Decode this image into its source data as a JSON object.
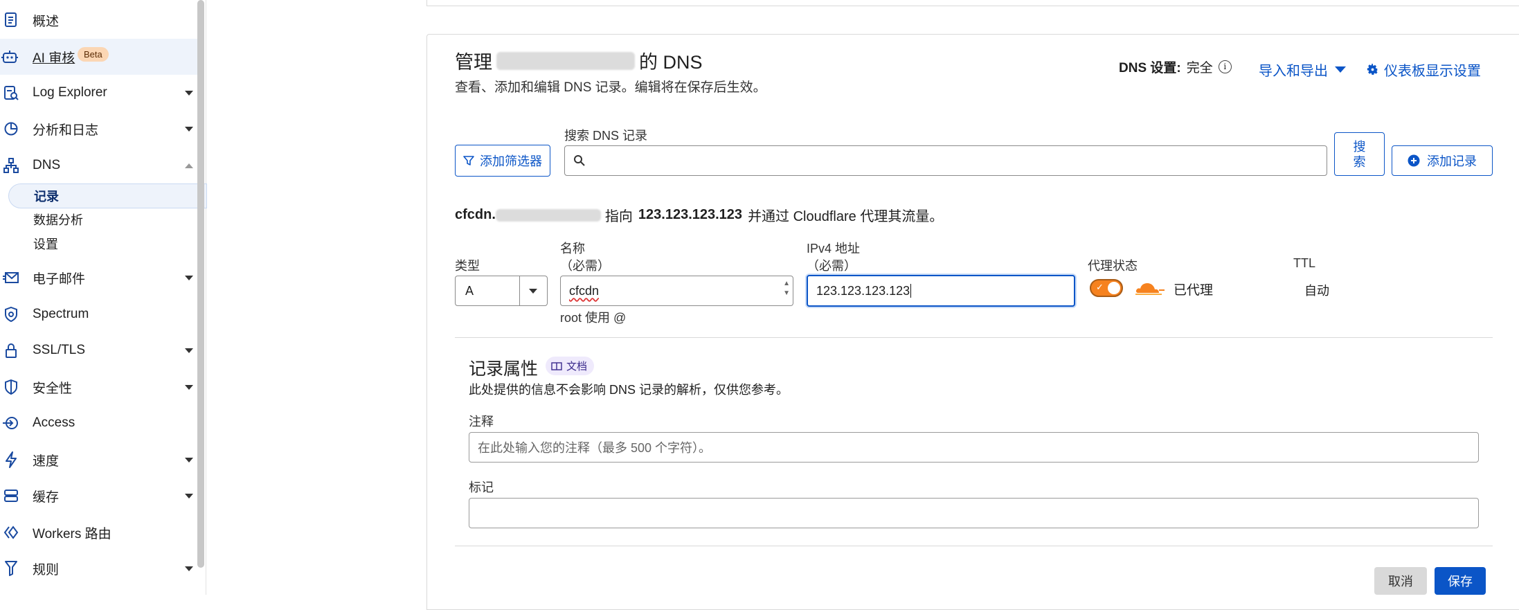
{
  "sidebar": {
    "items": [
      {
        "label": "概述",
        "icon": "document-icon"
      },
      {
        "label": "AI 审核",
        "icon": "robot-icon",
        "badge": "Beta"
      },
      {
        "label": "Log Explorer",
        "icon": "log-icon"
      },
      {
        "label": "分析和日志",
        "icon": "pie-chart-icon"
      },
      {
        "label": "DNS",
        "icon": "network-icon"
      },
      {
        "label": "电子邮件",
        "icon": "email-icon"
      },
      {
        "label": "Spectrum",
        "icon": "shield-cog-icon"
      },
      {
        "label": "SSL/TLS",
        "icon": "lock-icon"
      },
      {
        "label": "安全性",
        "icon": "shield-icon"
      },
      {
        "label": "Access",
        "icon": "access-icon"
      },
      {
        "label": "速度",
        "icon": "lightning-icon"
      },
      {
        "label": "缓存",
        "icon": "storage-icon"
      },
      {
        "label": "Workers 路由",
        "icon": "workers-icon"
      },
      {
        "label": "规则",
        "icon": "filter-rules-icon"
      }
    ],
    "dns_sub": [
      {
        "label": "记录",
        "active": true
      },
      {
        "label": "数据分析"
      },
      {
        "label": "设置"
      }
    ]
  },
  "header": {
    "title_prefix": "管理",
    "title_suffix": "的 DNS",
    "description": "查看、添加和编辑 DNS 记录。编辑将在保存后生效。",
    "dns_setting_label": "DNS 设置:",
    "dns_setting_value": "完全",
    "import_export": "导入和导出",
    "dashboard_settings": "仪表板显示设置"
  },
  "search": {
    "filter_button": "添加筛选器",
    "label": "搜索 DNS 记录",
    "placeholder": "",
    "search_button": "搜索",
    "add_record": "添加记录"
  },
  "record": {
    "proxy_sentence_name": "cfcdn.",
    "proxy_sentence_mid": "指向",
    "proxy_sentence_ip": "123.123.123.123",
    "proxy_sentence_end": "并通过 Cloudflare 代理其流量。",
    "type_label": "类型",
    "type_value": "A",
    "name_label": "名称",
    "name_required": "（必需）",
    "name_value": "cfcdn",
    "name_hint": "root 使用 @",
    "ipv4_label": "IPv4 地址",
    "ipv4_required": "（必需）",
    "ipv4_value": "123.123.123.123",
    "proxy_label": "代理状态",
    "proxy_value": "已代理",
    "ttl_label": "TTL",
    "ttl_value": "自动"
  },
  "attributes": {
    "title": "记录属性",
    "doc_badge": "文档",
    "description": "此处提供的信息不会影响 DNS 记录的解析，仅供您参考。",
    "comment_label": "注释",
    "comment_placeholder": "在此处输入您的注释（最多 500 个字符）。",
    "tags_label": "标记"
  },
  "actions": {
    "cancel": "取消",
    "save": "保存"
  },
  "colors": {
    "accent": "#0b55c7",
    "proxy_orange": "#f6821f"
  }
}
